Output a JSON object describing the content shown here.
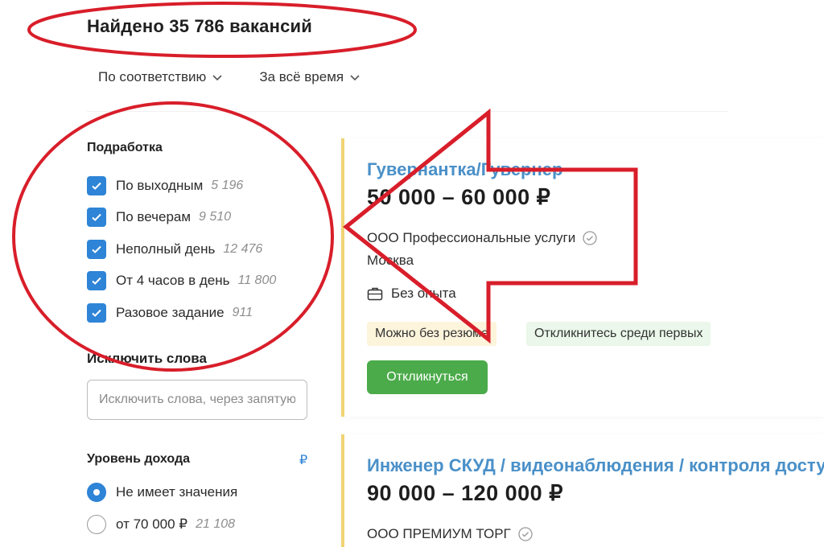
{
  "header": {
    "found_text": "Найдено 35 786 вакансий"
  },
  "sorts": [
    {
      "label": "По соответствию"
    },
    {
      "label": "За всё время"
    }
  ],
  "filters": {
    "part_time": {
      "title": "Подработка",
      "options": [
        {
          "label": "По выходным",
          "count": "5 196",
          "checked": true
        },
        {
          "label": "По вечерам",
          "count": "9 510",
          "checked": true
        },
        {
          "label": "Неполный день",
          "count": "12 476",
          "checked": true
        },
        {
          "label": "От 4 часов в день",
          "count": "11 800",
          "checked": true
        },
        {
          "label": "Разовое задание",
          "count": "911",
          "checked": true
        }
      ]
    },
    "exclude": {
      "title": "Исключить слова",
      "placeholder": "Исключить слова, через запятую"
    },
    "income": {
      "title": "Уровень дохода",
      "currency": "₽",
      "options": [
        {
          "label": "Не имеет значения",
          "count": "",
          "selected": true
        },
        {
          "label": "от 70 000 ₽",
          "count": "21 108",
          "selected": false
        }
      ]
    }
  },
  "vacancies": [
    {
      "title": "Гувернантка/Гувернер",
      "salary": "50 000 – 60 000 ₽",
      "company": "ООО Профессиональные услуги",
      "city": "Москва",
      "experience": "Без опыта",
      "tags": [
        "Можно без резюме",
        "Откликнитесь среди первых"
      ],
      "apply_label": "Откликнуться"
    },
    {
      "title": "Инженер СКУД / видеонаблюдения / контроля доступа",
      "salary": "90 000 – 120 000 ₽",
      "company": "ООО ПРЕМИУМ ТОРГ"
    }
  ],
  "colors": {
    "accent_blue": "#2e84d6",
    "title_blue": "#4a90c8",
    "apply_green": "#4bab4a",
    "annotation_red": "#d81e2a",
    "card_border": "#f0d473"
  },
  "icons": {
    "chevron": "chevron-down-icon",
    "checkbox": "check-icon",
    "verified": "verified-check-icon",
    "briefcase": "briefcase-icon"
  }
}
